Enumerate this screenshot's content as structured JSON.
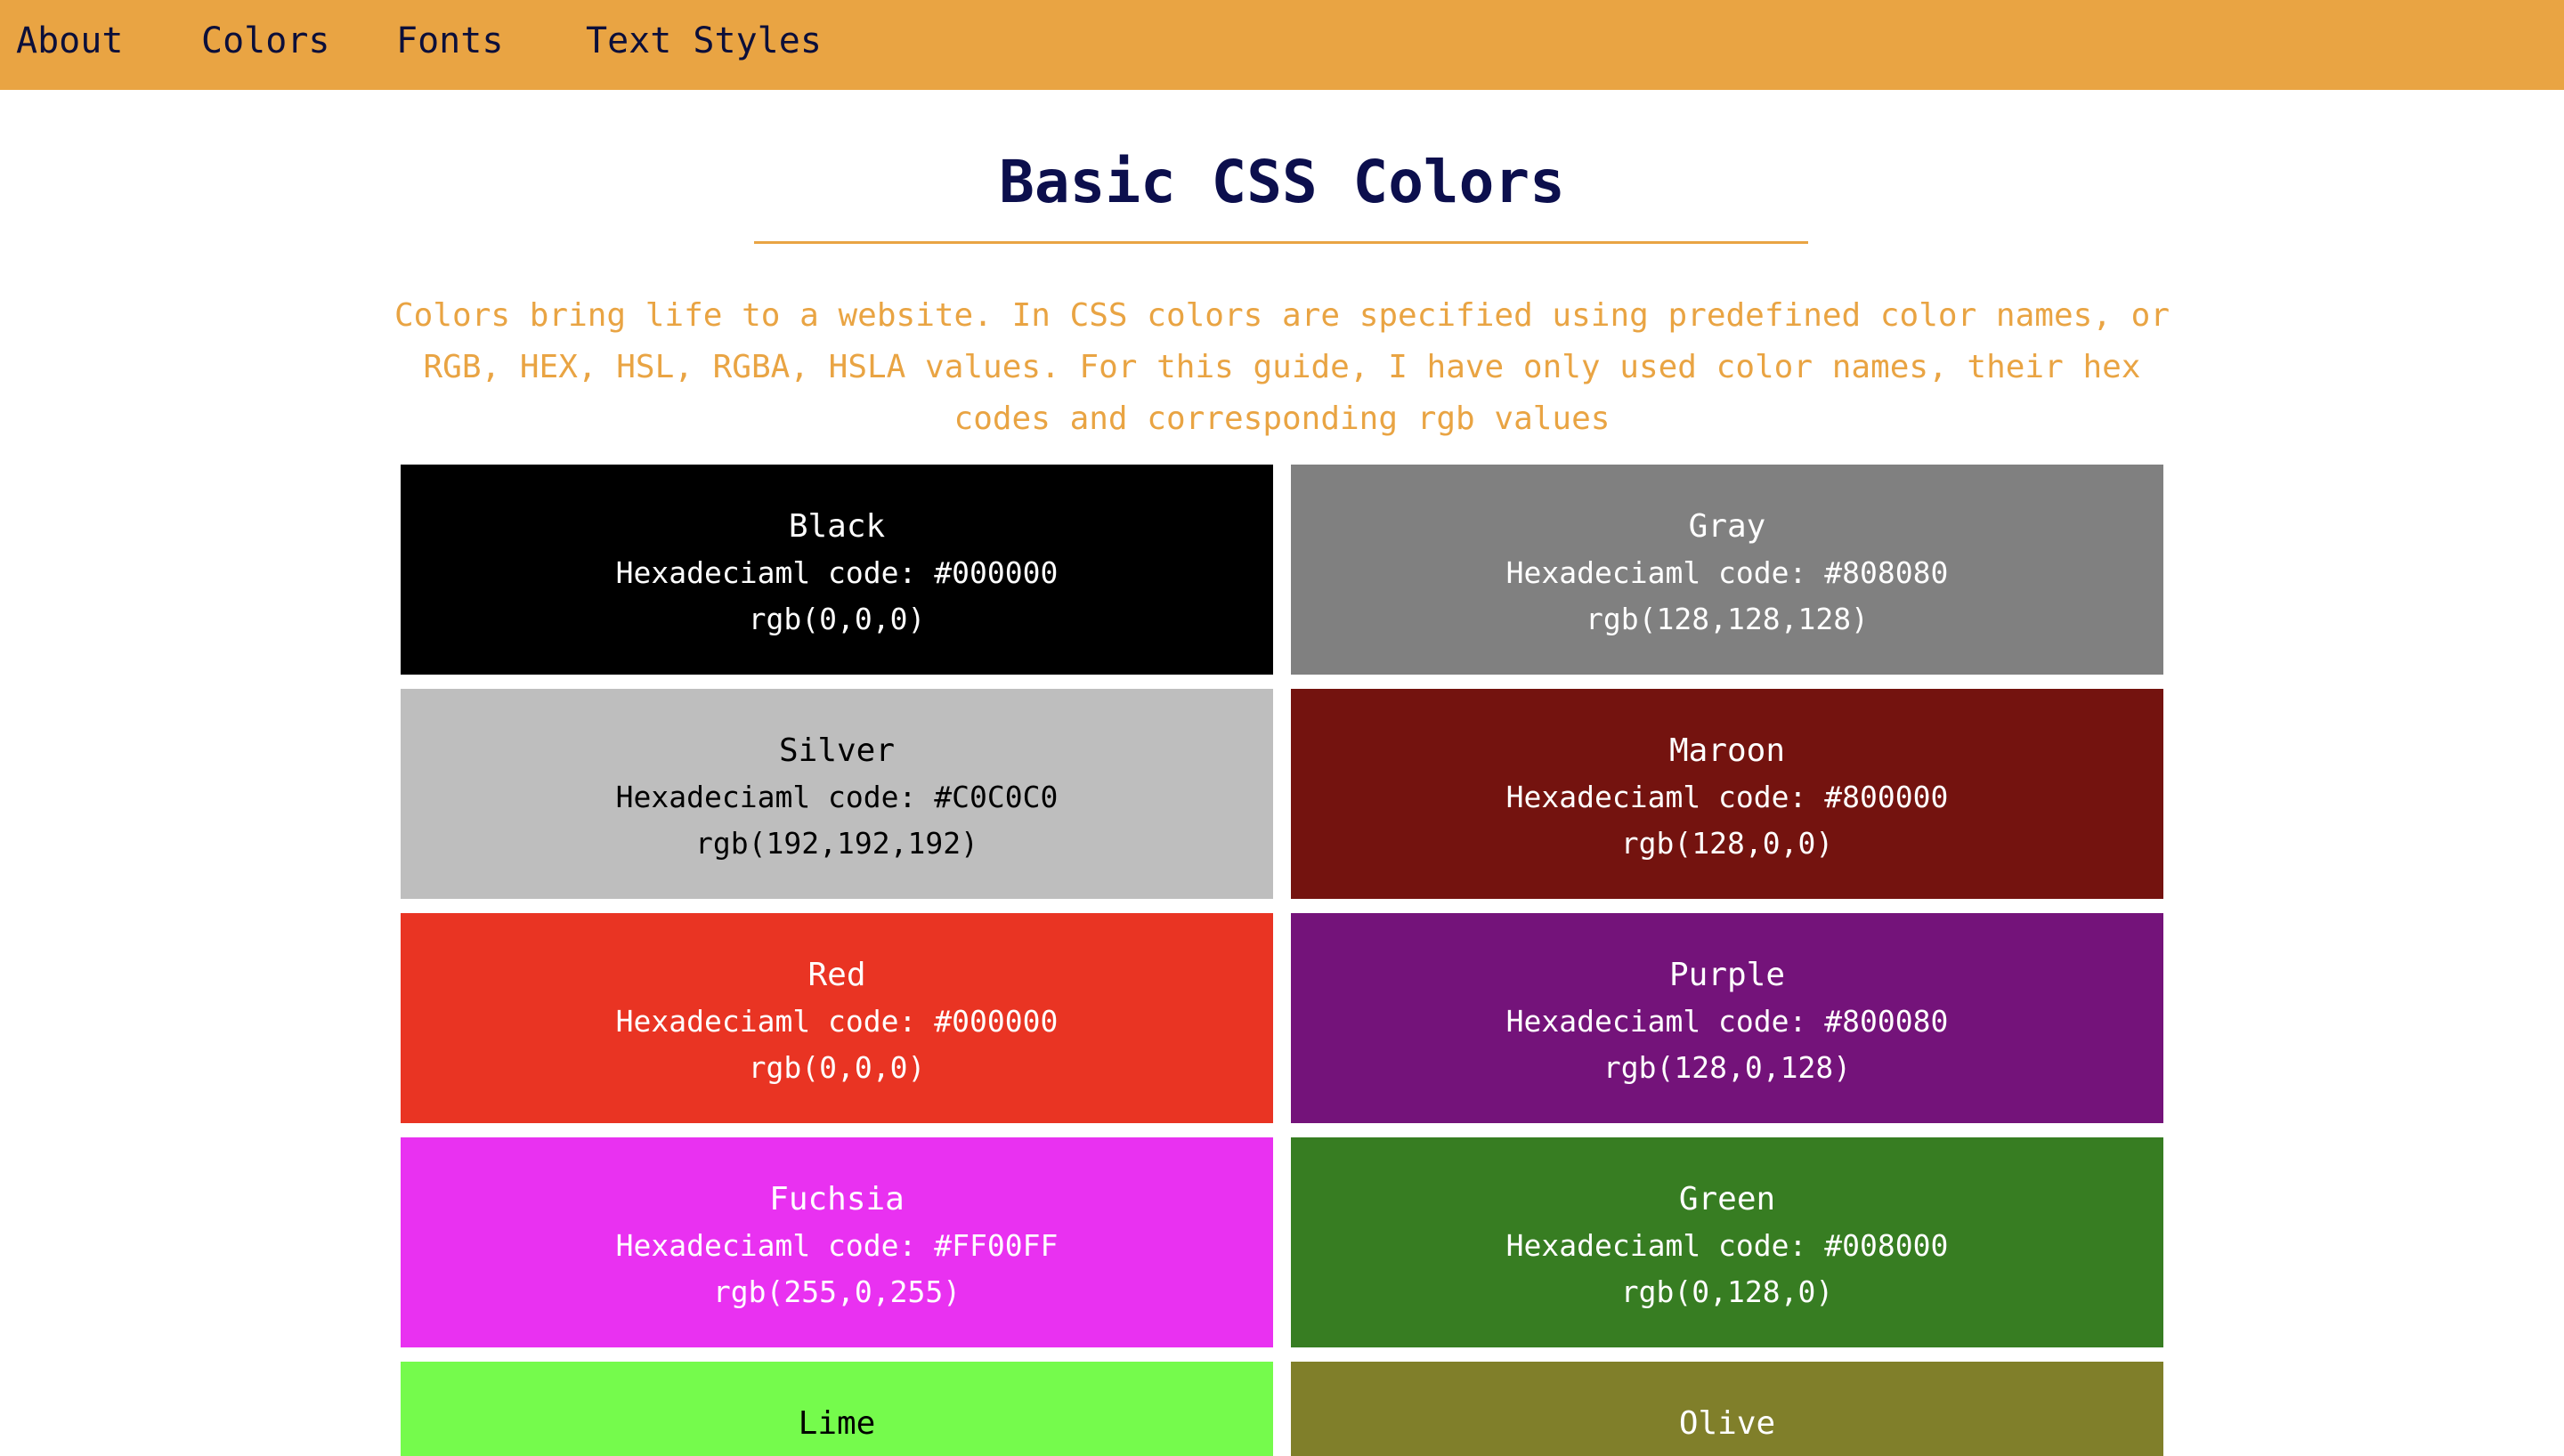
{
  "nav": {
    "items": [
      {
        "label": "About"
      },
      {
        "label": "Colors"
      },
      {
        "label": "Fonts"
      },
      {
        "label": "Text Styles"
      }
    ]
  },
  "page": {
    "title": "Basic CSS Colors",
    "intro": "Colors bring life to a website. In CSS colors are specified using predefined color names, or RGB, HEX, HSL, RGBA, HSLA values. For this guide, I have only used color names, their hex codes and corresponding rgb values"
  },
  "colors": {
    "accent": "#e9a443",
    "title_color": "#0c0f4d"
  },
  "swatches": [
    {
      "name": "Black",
      "hex": "Hexadeciaml code: #000000",
      "rgb": "rgb(0,0,0)",
      "bg": "#000000",
      "fg": "#ffffff"
    },
    {
      "name": "Gray",
      "hex": "Hexadeciaml code: #808080",
      "rgb": "rgb(128,128,128)",
      "bg": "#808080",
      "fg": "#ffffff"
    },
    {
      "name": "Silver",
      "hex": "Hexadeciaml code: #C0C0C0",
      "rgb": "rgb(192,192,192)",
      "bg": "#bebebe",
      "fg": "#000000"
    },
    {
      "name": "Maroon",
      "hex": "Hexadeciaml code: #800000",
      "rgb": "rgb(128,0,0)",
      "bg": "#74130f",
      "fg": "#ffffff"
    },
    {
      "name": "Red",
      "hex": "Hexadeciaml code: #000000",
      "rgb": "rgb(0,0,0)",
      "bg": "#e93423",
      "fg": "#ffffff"
    },
    {
      "name": "Purple",
      "hex": "Hexadeciaml code: #800080",
      "rgb": "rgb(128,0,128)",
      "bg": "#74137a",
      "fg": "#ffffff"
    },
    {
      "name": "Fuchsia",
      "hex": "Hexadeciaml code: #FF00FF",
      "rgb": "rgb(255,0,255)",
      "bg": "#e931f1",
      "fg": "#ffffff"
    },
    {
      "name": "Green",
      "hex": "Hexadeciaml code: #008000",
      "rgb": "rgb(0,128,0)",
      "bg": "#377d22",
      "fg": "#ffffff"
    },
    {
      "name": "Lime",
      "hex": "",
      "rgb": "",
      "bg": "#75fb4c",
      "fg": "#000000"
    },
    {
      "name": "Olive",
      "hex": "",
      "rgb": "",
      "bg": "#807f2a",
      "fg": "#ffffff"
    }
  ]
}
